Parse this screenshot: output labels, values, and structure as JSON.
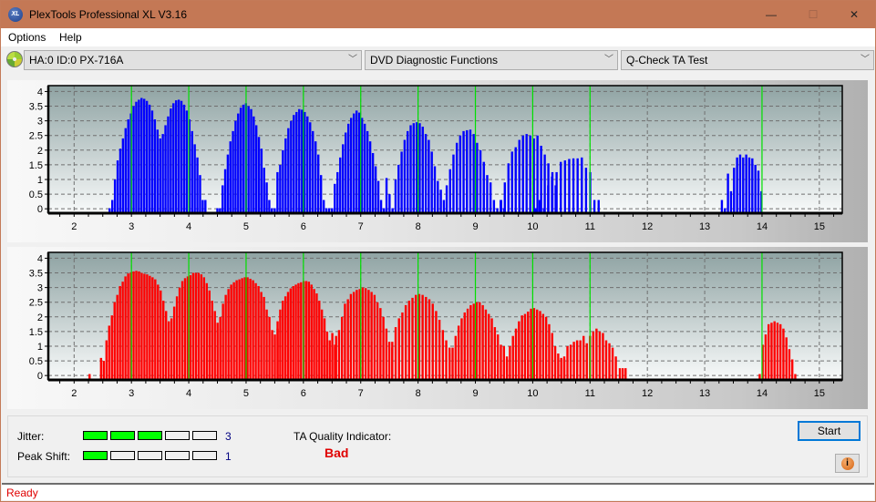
{
  "window": {
    "title": "PlexTools Professional XL V3.16",
    "logo_text": "XL",
    "minimize_glyph": "—",
    "maximize_glyph": "☐",
    "close_glyph": "✕"
  },
  "menu": {
    "items": [
      {
        "label": "Options"
      },
      {
        "label": "Help"
      }
    ]
  },
  "toolbar": {
    "drive_select": "HA:0 ID:0  PX-716A",
    "function_select": "DVD Diagnostic Functions",
    "test_select": "Q-Check TA Test",
    "chevron": "﹀"
  },
  "results": {
    "jitter_label": "Jitter:",
    "jitter_value": "3",
    "jitter_level": 3,
    "peak_shift_label": "Peak Shift:",
    "peak_shift_value": "1",
    "peak_shift_level": 1,
    "meter_segments": 5,
    "ta_quality_label": "TA Quality Indicator:",
    "ta_quality_value": "Bad",
    "start_label": "Start",
    "info_glyph": "i"
  },
  "status": {
    "text": "Ready"
  },
  "colors": {
    "top_bars": "#0000ff",
    "bottom_bars": "#ff0000",
    "marker_lines": "#00e000",
    "quality_bad": "#e00000",
    "meter_on": "#00ff00"
  },
  "chart_data": [
    {
      "type": "bar",
      "name": "TA land / top histogram",
      "xlim": [
        1.55,
        15.4
      ],
      "ylim": [
        -0.15,
        4.2
      ],
      "x_ticks": [
        2,
        3,
        4,
        5,
        6,
        7,
        8,
        9,
        10,
        11,
        12,
        13,
        14,
        15
      ],
      "y_ticks": [
        0,
        0.5,
        1,
        1.5,
        2,
        2.5,
        3,
        3.5,
        4
      ],
      "y_tick_labels": [
        "0",
        "0.5",
        "1",
        "1.5",
        "2",
        "2.5",
        "3",
        "3.5",
        "4"
      ],
      "marker_lines": [
        3,
        4,
        5,
        6,
        7,
        8,
        9,
        10,
        11,
        14
      ],
      "grid": true,
      "bar_color": "#0000ff",
      "peaks": [
        {
          "x_start": 2.62,
          "x_end": 4.29,
          "values": [
            0,
            0.3,
            1,
            1.65,
            2.05,
            2.4,
            2.75,
            3.05,
            3.25,
            3.5,
            3.65,
            3.72,
            3.78,
            3.75,
            3.68,
            3.55,
            3.35,
            3.05,
            2.7,
            2.4,
            2.55,
            2.85,
            3.15,
            3.42,
            3.6,
            3.7,
            3.72,
            3.68,
            3.55,
            3.35,
            3.05,
            2.65,
            2.2,
            1.75,
            1.15,
            0.3,
            0.3
          ]
        },
        {
          "x_start": 4.5,
          "x_end": 5.45,
          "values": [
            0,
            0,
            0.8,
            1.35,
            1.85,
            2.3,
            2.65,
            3.0,
            3.25,
            3.45,
            3.55,
            3.6,
            3.5,
            3.4,
            3.15,
            2.85,
            2.45,
            2.05,
            1.4,
            0.9,
            0.3,
            0
          ]
        },
        {
          "x_start": 5.5,
          "x_end": 6.45,
          "values": [
            0,
            1.25,
            1.5,
            2.0,
            2.4,
            2.75,
            3.0,
            3.2,
            3.3,
            3.4,
            3.38,
            3.3,
            3.15,
            2.95,
            2.65,
            2.3,
            1.85,
            1.15,
            0.3,
            0,
            0
          ]
        },
        {
          "x_start": 6.5,
          "x_end": 7.45,
          "values": [
            0,
            0.85,
            1.25,
            1.75,
            2.2,
            2.6,
            2.9,
            3.1,
            3.25,
            3.35,
            3.28,
            3.1,
            2.9,
            2.65,
            2.3,
            1.9,
            1.45,
            0.95,
            0.3,
            0,
            0
          ]
        },
        {
          "x_start": 7.45,
          "x_end": 8.45,
          "values": [
            1.05,
            0.5,
            0,
            1.0,
            1.5,
            1.95,
            2.35,
            2.65,
            2.85,
            2.92,
            2.95,
            2.92,
            2.8,
            2.55,
            2.35,
            1.95,
            1.45,
            0.95,
            0.65,
            0.3
          ]
        },
        {
          "x_start": 8.5,
          "x_end": 9.5,
          "values": [
            0.8,
            1.35,
            1.85,
            2.25,
            2.5,
            2.65,
            2.68,
            2.7,
            2.55,
            2.25,
            2.0,
            1.6,
            1.15,
            0.9,
            0.3,
            0,
            0.3,
            0
          ]
        },
        {
          "x_start": 9.45,
          "x_end": 10.4,
          "values": [
            0.3,
            0.9,
            1.55,
            1.95,
            2.1,
            2.35,
            2.5,
            2.55,
            2.5,
            2.4,
            2.5,
            2.15,
            1.85,
            1.55,
            1.1,
            0.8
          ]
        },
        {
          "x_start": 10.05,
          "x_end": 11.15,
          "values": [
            0,
            0.3,
            0,
            0.8,
            1.25,
            1.25,
            1.6,
            1.65,
            1.7,
            1.72,
            1.72,
            1.75,
            1.4,
            1.25,
            0.3,
            0.3
          ]
        },
        {
          "x_start": 13.3,
          "x_end": 13.99,
          "values": [
            0.3,
            0,
            1.2,
            0.6,
            1.4,
            1.75,
            1.85,
            1.75,
            1.85,
            1.75,
            1.72,
            1.5,
            1.3,
            0.6
          ]
        }
      ]
    },
    {
      "type": "bar",
      "name": "TA groove / bottom histogram",
      "xlim": [
        1.55,
        15.4
      ],
      "ylim": [
        -0.15,
        4.2
      ],
      "x_ticks": [
        2,
        3,
        4,
        5,
        6,
        7,
        8,
        9,
        10,
        11,
        12,
        13,
        14,
        15
      ],
      "y_ticks": [
        0,
        0.5,
        1,
        1.5,
        2,
        2.5,
        3,
        3.5,
        4
      ],
      "y_tick_labels": [
        "0",
        "0.5",
        "1",
        "1.5",
        "2",
        "2.5",
        "3",
        "3.5",
        "4"
      ],
      "marker_lines": [
        3,
        4,
        5,
        6,
        7,
        8,
        9,
        10,
        11,
        14
      ],
      "grid": true,
      "bar_color": "#ff0000",
      "peaks": [
        {
          "x_start": 2.27,
          "x_end": 2.27,
          "values": [
            0.05
          ]
        },
        {
          "x_start": 2.47,
          "x_end": 4.55,
          "values": [
            0.6,
            0.5,
            1.2,
            1.7,
            2.05,
            2.5,
            2.75,
            3.05,
            3.2,
            3.38,
            3.48,
            3.52,
            3.55,
            3.57,
            3.55,
            3.5,
            3.47,
            3.45,
            3.4,
            3.35,
            3.28,
            3.1,
            2.9,
            2.55,
            2.2,
            1.85,
            1.95,
            2.35,
            2.7,
            3.0,
            3.22,
            3.32,
            3.38,
            3.42,
            3.5,
            3.5,
            3.5,
            3.45,
            3.35,
            3.15,
            2.9,
            2.55,
            2.2,
            1.8,
            1.6
          ]
        },
        {
          "x_start": 4.55,
          "x_end": 5.55,
          "values": [
            2.0,
            2.45,
            2.75,
            2.95,
            3.1,
            3.18,
            3.25,
            3.28,
            3.32,
            3.35,
            3.35,
            3.3,
            3.25,
            3.15,
            3.05,
            2.85,
            2.68,
            2.25,
            2.0,
            1.55,
            1.4,
            1.6
          ]
        },
        {
          "x_start": 5.55,
          "x_end": 6.55,
          "values": [
            1.85,
            2.25,
            2.55,
            2.7,
            2.85,
            2.97,
            3.05,
            3.1,
            3.15,
            3.18,
            3.22,
            3.22,
            3.2,
            3.1,
            2.95,
            2.8,
            2.55,
            2.25,
            1.95,
            1.5,
            1.2,
            1.45,
            1.05
          ]
        },
        {
          "x_start": 6.57,
          "x_end": 7.55,
          "values": [
            1.35,
            1.55,
            2.0,
            2.45,
            2.6,
            2.78,
            2.85,
            2.92,
            2.95,
            3.0,
            2.98,
            2.92,
            2.85,
            2.75,
            2.5,
            2.3,
            2.0,
            1.6,
            1.15,
            0.95
          ]
        },
        {
          "x_start": 7.55,
          "x_end": 8.55,
          "values": [
            1.15,
            1.65,
            1.95,
            2.15,
            2.4,
            2.55,
            2.65,
            2.75,
            2.78,
            2.75,
            2.68,
            2.6,
            2.45,
            2.2,
            1.9,
            1.55,
            1.2,
            0.95
          ]
        },
        {
          "x_start": 8.55,
          "x_end": 9.55,
          "values": [
            0.75,
            0.95,
            1.35,
            1.7,
            1.95,
            2.15,
            2.28,
            2.4,
            2.45,
            2.5,
            2.5,
            2.4,
            2.25,
            2.1,
            1.95,
            1.65,
            1.4,
            1.05,
            1.0,
            0.65
          ]
        },
        {
          "x_start": 9.55,
          "x_end": 10.55,
          "values": [
            0.55,
            1.0,
            1.35,
            1.6,
            1.85,
            2.05,
            2.1,
            2.18,
            2.28,
            2.3,
            2.25,
            2.2,
            2.1,
            2.0,
            1.75,
            1.45,
            1.0,
            0.75,
            0.6,
            0.55
          ]
        },
        {
          "x_start": 10.55,
          "x_end": 11.45,
          "values": [
            0.65,
            1.0,
            1.05,
            1.15,
            1.2,
            1.2,
            1.35,
            1.1,
            1.35,
            1.5,
            1.6,
            1.5,
            1.45,
            1.2,
            1.1,
            0.95,
            0.65
          ]
        },
        {
          "x_start": 11.52,
          "x_end": 11.62,
          "values": [
            0.25,
            0.25,
            0.25
          ]
        },
        {
          "x_start": 13.96,
          "x_end": 14.58,
          "values": [
            0.05,
            1.05,
            1.4,
            1.75,
            1.8,
            1.85,
            1.8,
            1.75,
            1.6,
            1.3,
            0.9,
            0.55,
            0.05
          ]
        }
      ]
    }
  ]
}
